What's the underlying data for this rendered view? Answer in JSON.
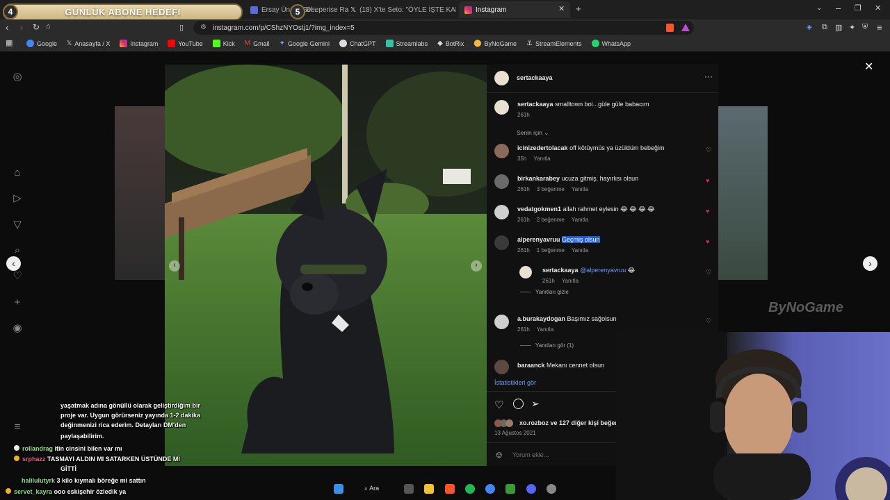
{
  "overlay": {
    "goal_label": "GÜNLÜK ABONE HEDEFİ",
    "goal_current": "4",
    "goal_target": "5",
    "sponsor_logo": "ByNoGame"
  },
  "browser": {
    "tabs": [
      {
        "label": "Ersay Üner - Sel...",
        "active": false
      },
      {
        "label": "Deeperise Ra",
        "active": false
      },
      {
        "label": "(18) X'te Seto: \"ÖYLE İŞTE KAFAMIZA",
        "active": false
      },
      {
        "label": "Instagram",
        "active": true
      }
    ],
    "url": "instagram.com/p/CShzNYOstj1/?img_index=5",
    "bookmarks": [
      "Google",
      "Anasayfa / X",
      "Instagram",
      "YouTube",
      "Kick",
      "Gmail",
      "Google Gemini",
      "ChatGPT",
      "Streamlabs",
      "BotRix",
      "ByNoGame",
      "StreamElements",
      "WhatsApp"
    ]
  },
  "post": {
    "author": "sertackaaya",
    "caption_user": "sertackaaya",
    "caption_text": "smalltown boi...güle güle babacım",
    "caption_time": "261h",
    "sort_label": "Senin için",
    "comments": [
      {
        "user": "icinizedertolacak",
        "text": "off kötüymüs ya üzüldüm bebeğim",
        "time": "35h",
        "likes": "",
        "reply": "Yanıtla",
        "liked": false
      },
      {
        "user": "birkankarabey",
        "text": "ucuza gitmiş. hayırlısı olsun",
        "time": "261h",
        "likes": "3 beğenme",
        "reply": "Yanıtla",
        "liked": true
      },
      {
        "user": "vedatgokmen1",
        "text": "allah rahmet eylesin 😂 😂 😂 😂",
        "time": "261h",
        "likes": "2 beğenme",
        "reply": "Yanıtla",
        "liked": true
      },
      {
        "user": "alperenyavruu",
        "text": "Geçmiş olsun",
        "time": "261h",
        "likes": "1 beğenme",
        "reply": "Yanıtla",
        "liked": true
      },
      {
        "user": "a.burakaydogan",
        "text": "Başımız sağolsun",
        "time": "261h",
        "likes": "",
        "reply": "Yanıtla",
        "liked": false
      },
      {
        "user": "baraanck",
        "text": "Mekanı cennet olsun",
        "time": "",
        "likes": "",
        "reply": "",
        "liked": false
      }
    ],
    "reply": {
      "user": "sertackaaya",
      "mention": "@alperenyavruu",
      "emoji": "😂",
      "time": "261h",
      "reply": "Yanıtla"
    },
    "hide_replies": "Yanıtları gizle",
    "view_replies": "Yanıtları gör (1)",
    "insights": "İstatistikleri gör",
    "liked_by": "xo.rozboz ve 127 diğer kişi beğen",
    "date": "13 Ağustos 2021",
    "comment_placeholder": "Yorum ekle..."
  },
  "chat": [
    {
      "user": "",
      "text": "yaşatmak adına gönüllü olarak geliştirdiğim bir"
    },
    {
      "user": "",
      "text": "proje var. Uygun görürseniz yayında 1-2 dakika"
    },
    {
      "user": "",
      "text": "değinmenizi rica ederim. Detayları DM'den"
    },
    {
      "user": "",
      "text": "paylaşabilirim."
    },
    {
      "user": "rollandrag",
      "text": "itin cinsini bilen var mı"
    },
    {
      "user": "srphazz",
      "text": "TASMAYI ALDIN MI SATARKEN ÜSTÜNDE Mİ"
    },
    {
      "user": "",
      "text": "GİTTİ"
    },
    {
      "user": "halilulutyrk",
      "text": "3 kilo kıymalı böreğe mi sattın"
    },
    {
      "user": "servet_kayra",
      "text": "ooo eskişehir özledik ya"
    }
  ],
  "taskbar": {
    "search_label": "Ara"
  },
  "colors": {
    "instagram_accent": "#e0245e",
    "link": "#4f8ef7",
    "highlight": "#1f5bd1"
  }
}
